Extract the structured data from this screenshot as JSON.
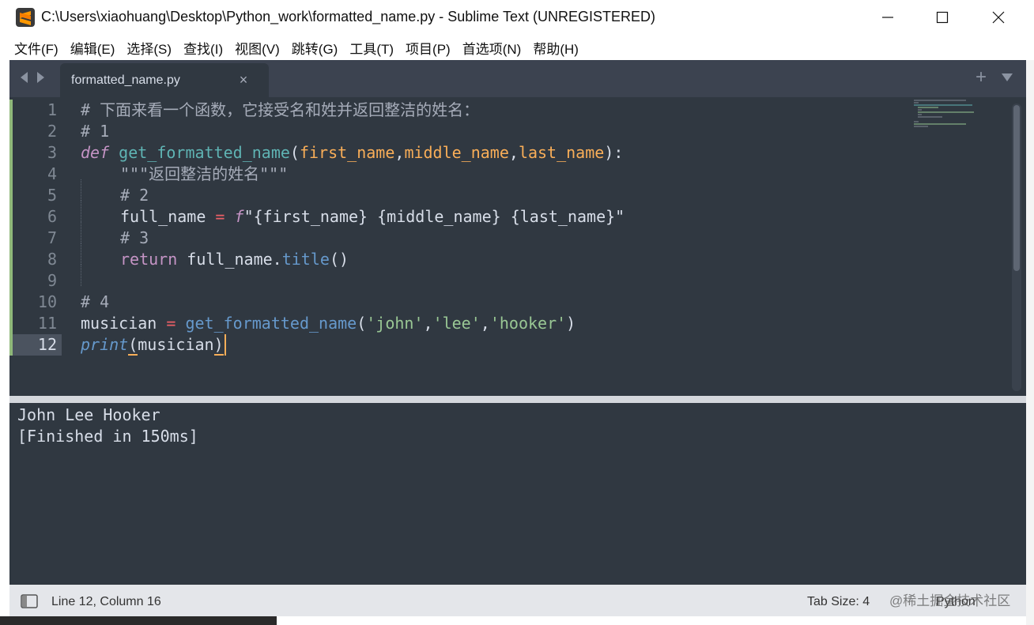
{
  "window": {
    "title": "C:\\Users\\xiaohuang\\Desktop\\Python_work\\formatted_name.py - Sublime Text (UNREGISTERED)",
    "app_icon": "sublime-text-icon",
    "accent_color": "#f9ae58"
  },
  "menu": [
    "文件(F)",
    "编辑(E)",
    "选择(S)",
    "查找(I)",
    "视图(V)",
    "跳转(G)",
    "工具(T)",
    "项目(P)",
    "首选项(N)",
    "帮助(H)"
  ],
  "tabs": {
    "active": {
      "label": "formatted_name.py",
      "close": "×"
    },
    "plus": "+"
  },
  "editor": {
    "line_numbers": [
      "1",
      "2",
      "3",
      "4",
      "5",
      "6",
      "7",
      "8",
      "9",
      "10",
      "11",
      "12"
    ],
    "active_line": "12",
    "code": {
      "l1": "# 下面来看一个函数，它接受名和姓并返回整洁的姓名：",
      "l2": "# 1",
      "l3_kw": "def",
      "l3_fn": "get_formatted_name",
      "l3_p1": "first_name",
      "l3_p2": "middle_name",
      "l3_p3": "last_name",
      "l4": "\"\"\"返回整洁的姓名\"\"\"",
      "l5": "# 2",
      "l6_var": "full_name",
      "l6_op": "=",
      "l6_f": "f",
      "l6_str": "\"{first_name} {middle_name} {last_name}\"",
      "l7": "# 3",
      "l8_kw": "return",
      "l8_obj": "full_name",
      "l8_attr": "title",
      "l10": "# 4",
      "l11_var": "musician",
      "l11_op": "=",
      "l11_fn": "get_formatted_name",
      "l11_a1": "'john'",
      "l11_a2": "'lee'",
      "l11_a3": "'hooker'",
      "l12_fn": "print",
      "l12_arg": "musician"
    }
  },
  "output": {
    "lines": [
      "John Lee Hooker",
      "[Finished in 150ms]"
    ]
  },
  "status": {
    "position": "Line 12, Column 16",
    "tab_size": "Tab Size: 4",
    "syntax": "Python"
  },
  "watermark": "@稀土掘金技术社区"
}
